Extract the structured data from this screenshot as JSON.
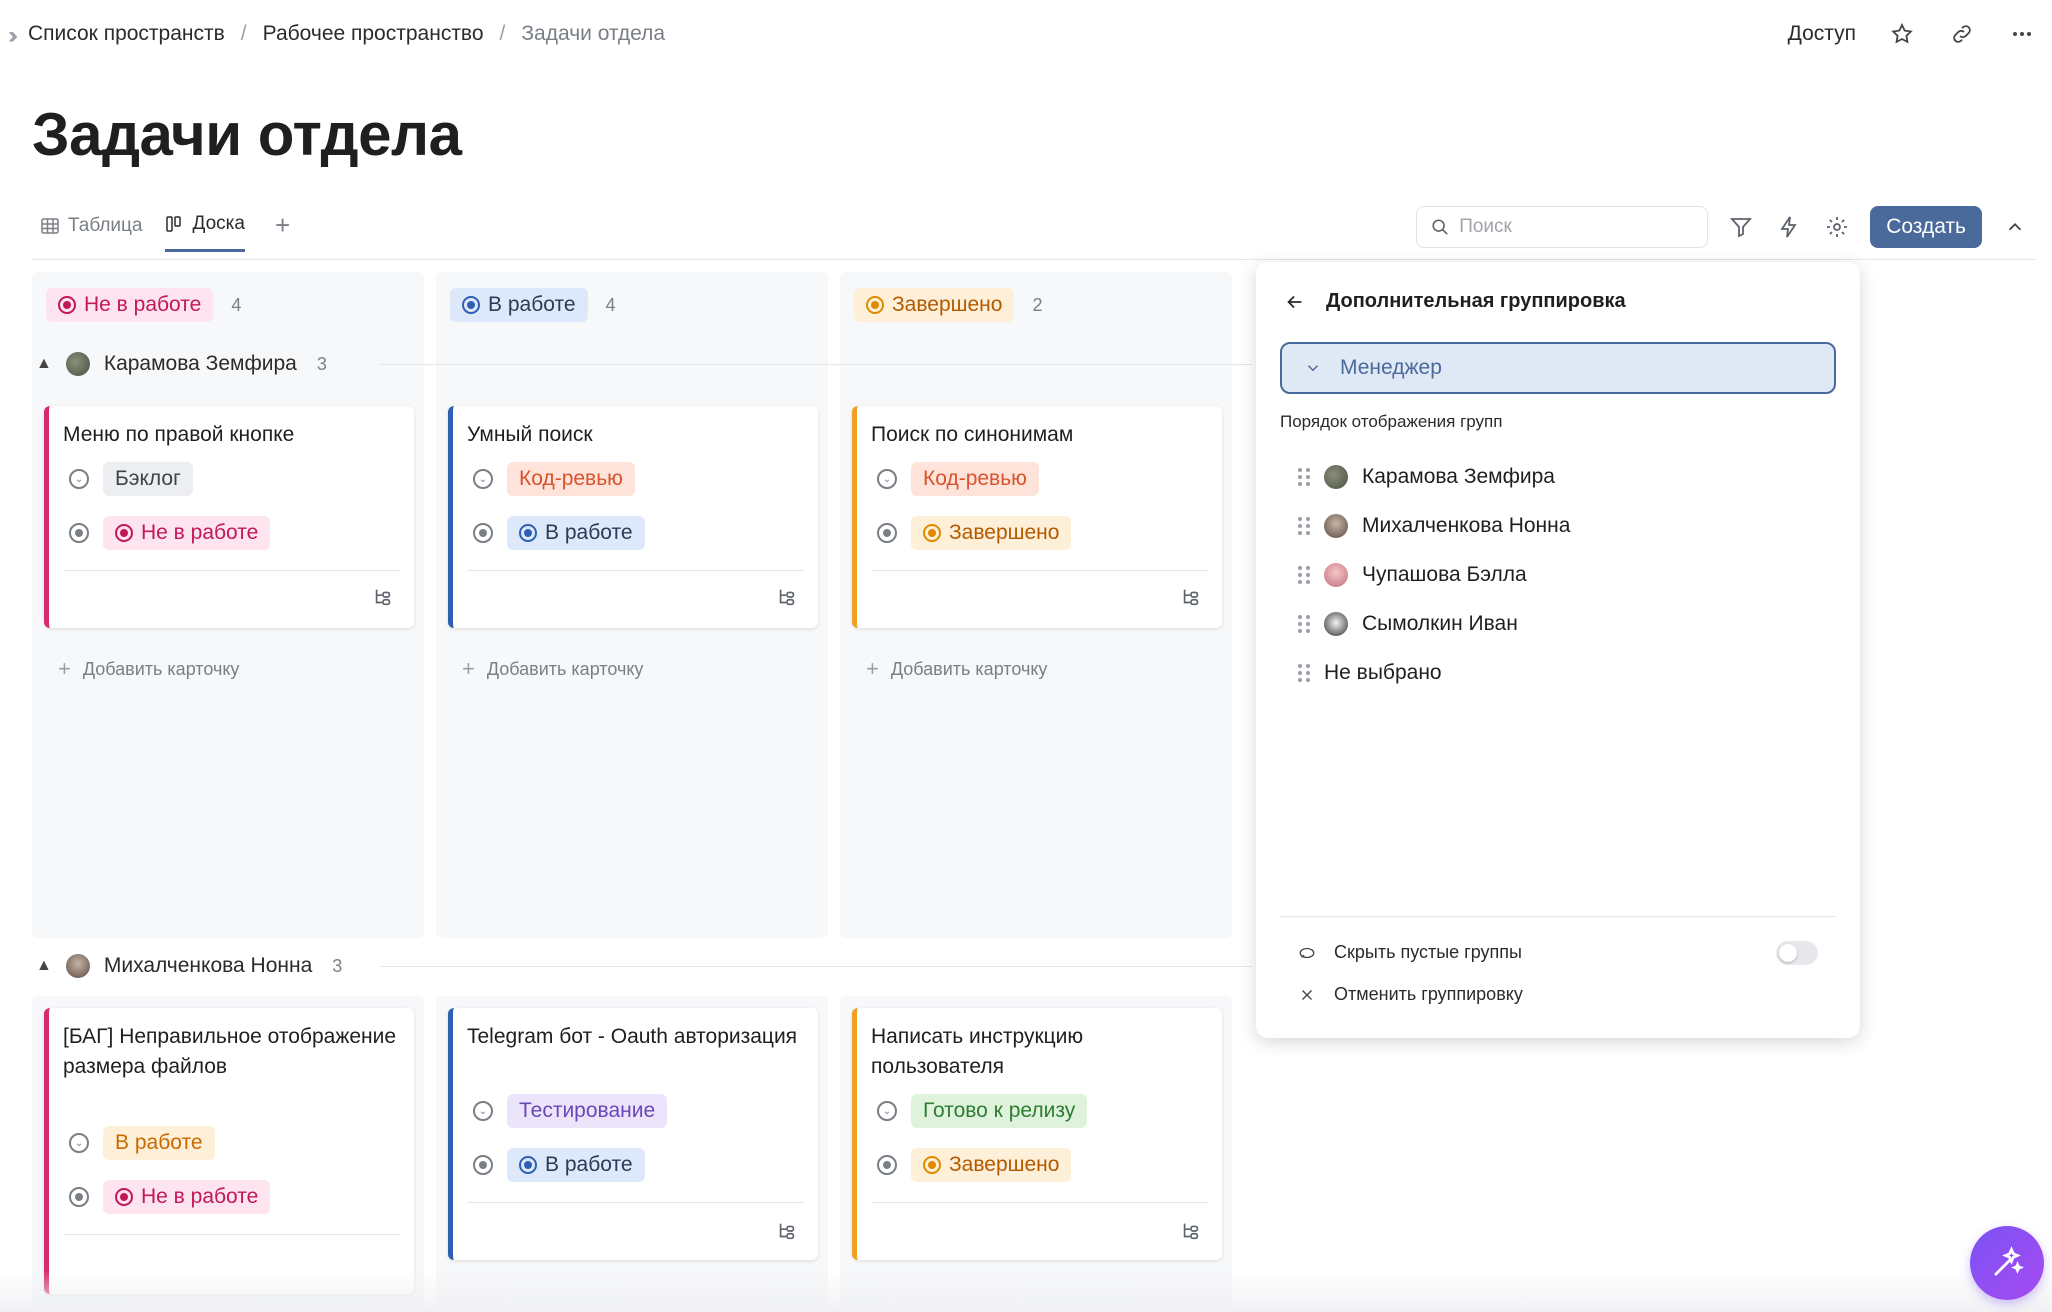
{
  "breadcrumb": {
    "items": [
      "Список пространств",
      "Рабочее пространство",
      "Задачи отдела"
    ]
  },
  "header_actions": {
    "access": "Доступ"
  },
  "page": {
    "title": "Задачи отдела"
  },
  "views": {
    "tabs": [
      {
        "label": "Таблица",
        "icon": "table-icon"
      },
      {
        "label": "Доска",
        "icon": "board-icon"
      }
    ]
  },
  "toolbar": {
    "search_placeholder": "Поиск",
    "create_label": "Создать"
  },
  "colors": {
    "accent": "#4a6a9c",
    "not_in_work": "#c2185b",
    "in_work": "#2f5fb3",
    "done": "#e08a00",
    "code_review": "#d9532b",
    "backlog": "#4b4f55",
    "testing": "#6a47b8",
    "ready": "#2e7d32"
  },
  "columns": [
    {
      "label": "Не в работе",
      "count": "4"
    },
    {
      "label": "В работе",
      "count": "4"
    },
    {
      "label": "Завершено",
      "count": "2"
    }
  ],
  "groups": [
    {
      "name": "Карамова Земфира",
      "count": "3",
      "cards": [
        {
          "title": "Меню по правой кнопке",
          "stage": "Бэклог",
          "status": "Не в работе"
        },
        {
          "title": "Умный поиск",
          "stage": "Код-ревью",
          "status": "В работе"
        },
        {
          "title": "Поиск по синонимам",
          "stage": "Код-ревью",
          "status": "Завершено"
        }
      ]
    },
    {
      "name": "Михалченкова Нонна",
      "count": "3",
      "cards": [
        {
          "title": "[БАГ] Неправильное отображение размера файлов",
          "stage": "В работе",
          "status": "Не в работе"
        },
        {
          "title": "Telegram бот - Oauth авторизация",
          "stage": "Тестирование",
          "status": "В работе"
        },
        {
          "title": "Написать инструкцию пользователя",
          "stage": "Готово к релизу",
          "status": "Завершено"
        }
      ]
    }
  ],
  "add_card_label": "Добавить карточку",
  "grouping_panel": {
    "title": "Дополнительная группировка",
    "selected": "Менеджер",
    "order_title": "Порядок отображения групп",
    "items": [
      "Карамова Земфира",
      "Михалченкова Нонна",
      "Чупашова Бэлла",
      "Сымолкин Иван",
      "Не выбрано"
    ],
    "hide_empty": "Скрыть пустые группы",
    "cancel_grouping": "Отменить группировку"
  }
}
